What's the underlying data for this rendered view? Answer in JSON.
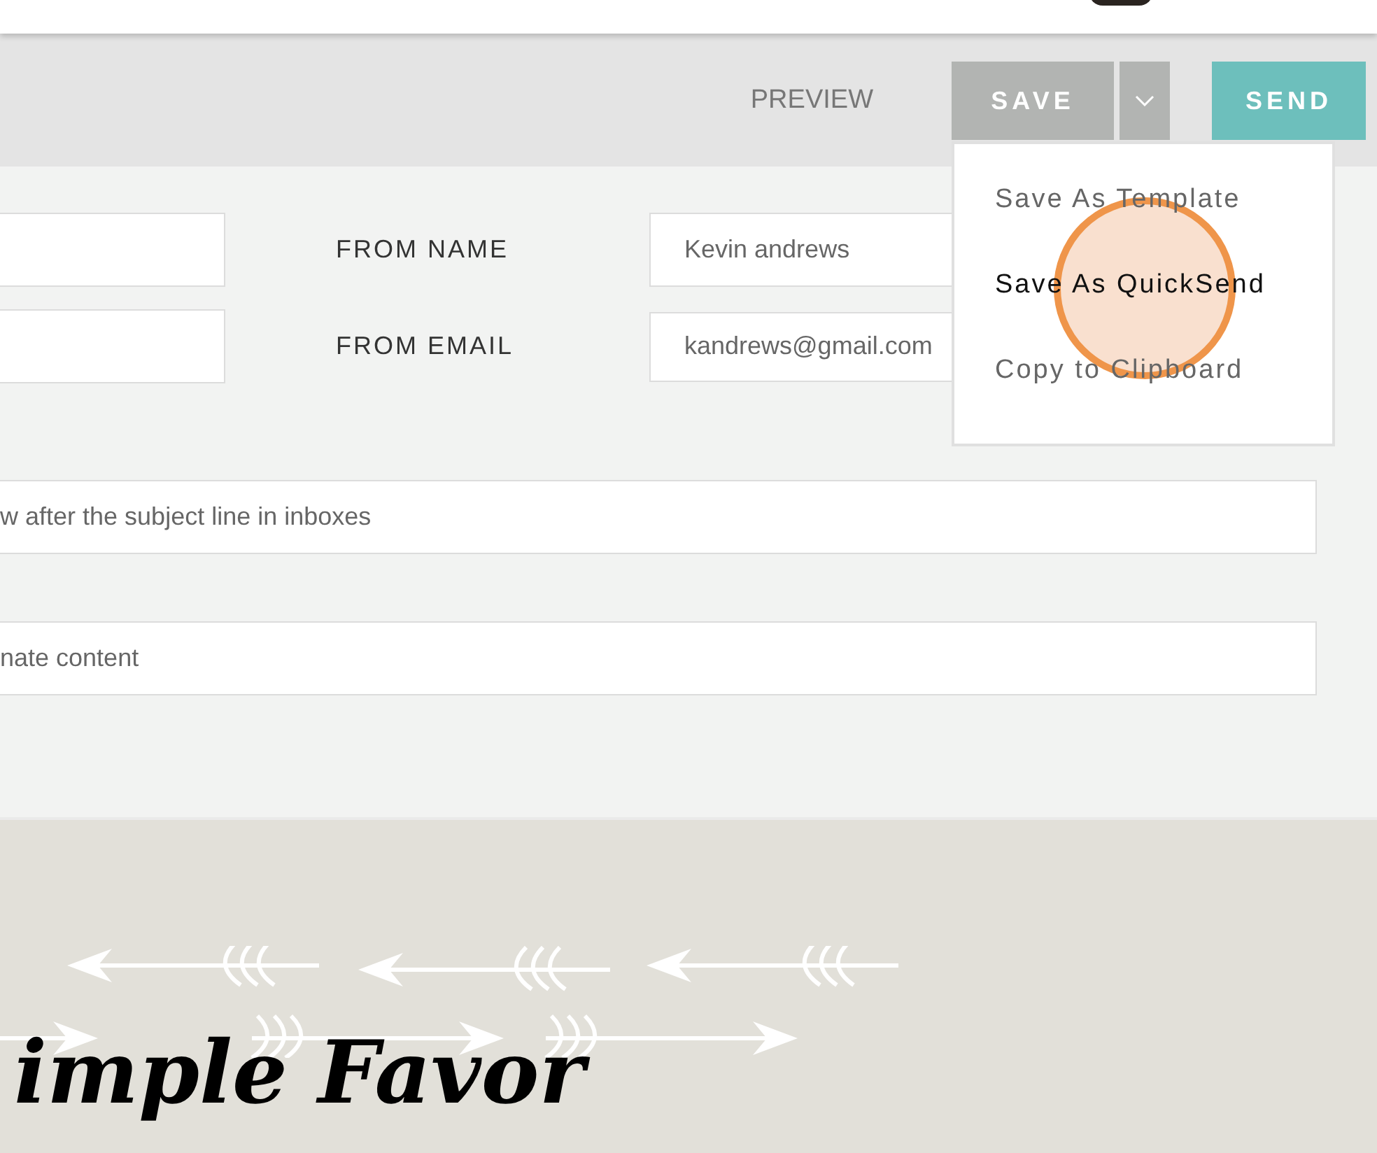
{
  "toolbar": {
    "preview": "PREVIEW",
    "save": "SAVE",
    "send": "SEND"
  },
  "save_menu": {
    "expanded": true,
    "items": [
      {
        "label": "Save As Template",
        "selected": false
      },
      {
        "label": "Save As QuickSend",
        "selected": true
      },
      {
        "label": "Copy to Clipboard",
        "selected": false
      }
    ]
  },
  "form": {
    "from_name": {
      "label": "FROM NAME",
      "value": "Kevin andrews"
    },
    "from_email": {
      "label": "FROM EMAIL",
      "value": "kandrews@gmail.com"
    },
    "preheader": {
      "placeholder": "w after the subject line in inboxes"
    },
    "alternate": {
      "placeholder": "nate content"
    }
  },
  "email_preview": {
    "title": "imple Favor"
  }
}
